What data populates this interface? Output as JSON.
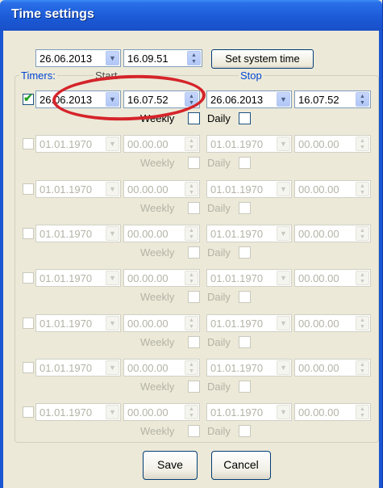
{
  "window": {
    "title": "Time settings"
  },
  "system": {
    "date": "26.06.2013",
    "time": "16.09.51",
    "set_button": "Set system time"
  },
  "timers": {
    "group_label": "Timers:",
    "start_label": "Start",
    "stop_label": "Stop",
    "weekly_label": "Weekly",
    "daily_label": "Daily",
    "rows": [
      {
        "enabled": true,
        "start_date": "26.06.2013",
        "start_time": "16.07.52",
        "stop_date": "26.06.2013",
        "stop_time": "16.07.52"
      },
      {
        "enabled": false,
        "start_date": "01.01.1970",
        "start_time": "00.00.00",
        "stop_date": "01.01.1970",
        "stop_time": "00.00.00"
      },
      {
        "enabled": false,
        "start_date": "01.01.1970",
        "start_time": "00.00.00",
        "stop_date": "01.01.1970",
        "stop_time": "00.00.00"
      },
      {
        "enabled": false,
        "start_date": "01.01.1970",
        "start_time": "00.00.00",
        "stop_date": "01.01.1970",
        "stop_time": "00.00.00"
      },
      {
        "enabled": false,
        "start_date": "01.01.1970",
        "start_time": "00.00.00",
        "stop_date": "01.01.1970",
        "stop_time": "00.00.00"
      },
      {
        "enabled": false,
        "start_date": "01.01.1970",
        "start_time": "00.00.00",
        "stop_date": "01.01.1970",
        "stop_time": "00.00.00"
      },
      {
        "enabled": false,
        "start_date": "01.01.1970",
        "start_time": "00.00.00",
        "stop_date": "01.01.1970",
        "stop_time": "00.00.00"
      },
      {
        "enabled": false,
        "start_date": "01.01.1970",
        "start_time": "00.00.00",
        "stop_date": "01.01.1970",
        "stop_time": "00.00.00"
      }
    ]
  },
  "buttons": {
    "save": "Save",
    "cancel": "Cancel"
  },
  "colors": {
    "titlebar": "#1f5fdc",
    "group_label": "#0046d5",
    "highlight_ring": "#d5242a",
    "check": "#21a121"
  },
  "icons": {
    "combo_arrow": "chevron-down-icon",
    "spinner": "spinner-arrows-icon",
    "check": "checkmark-icon"
  }
}
